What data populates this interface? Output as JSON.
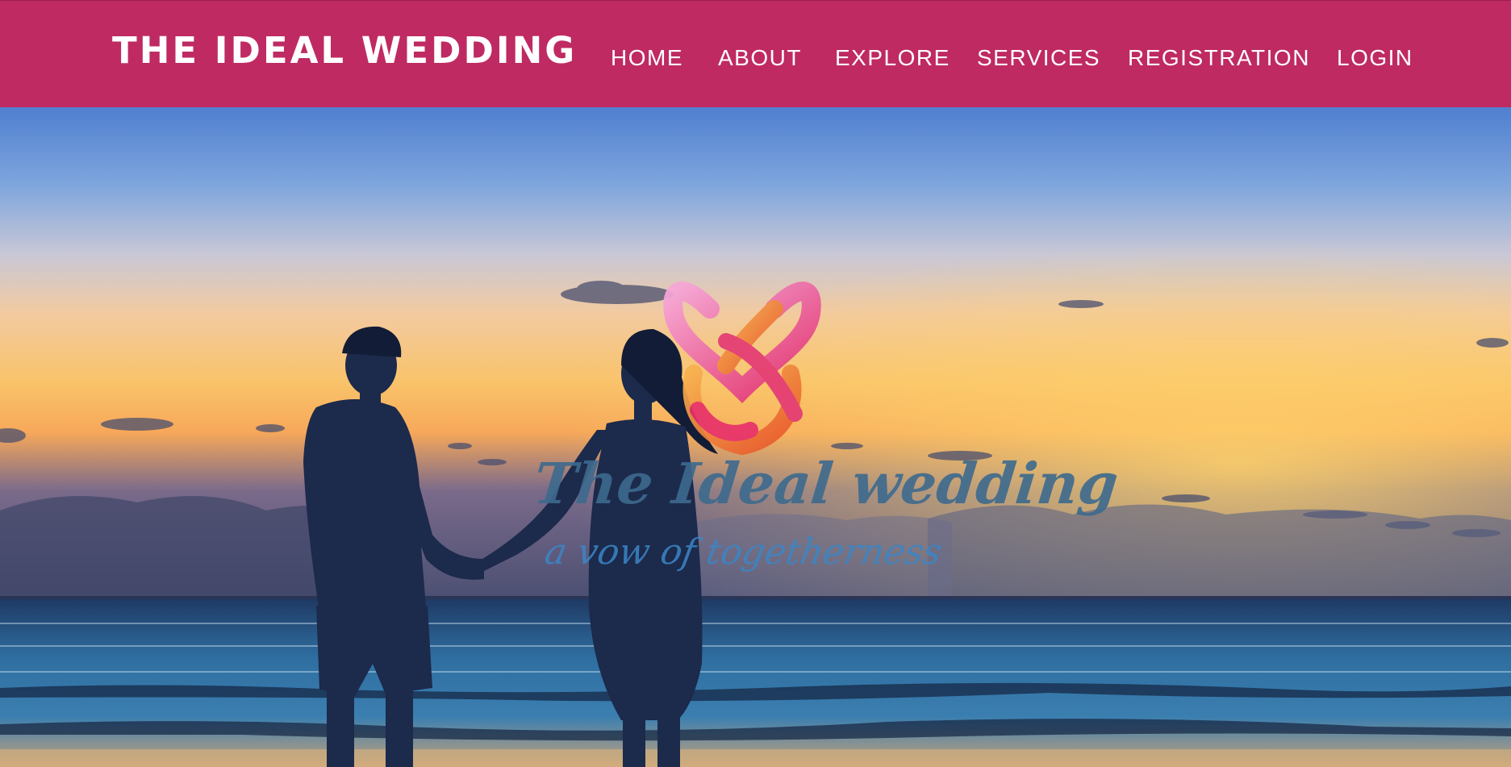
{
  "brand": {
    "name": "THE IDEAL WEDDING"
  },
  "nav": {
    "items": [
      {
        "label": "HOME"
      },
      {
        "label": "ABOUT"
      },
      {
        "label": "EXPLORE"
      },
      {
        "label": "SERVICES"
      },
      {
        "label": "REGISTRATION"
      },
      {
        "label": "LOGIN"
      }
    ]
  },
  "hero": {
    "logo_title": "The Ideal wedding",
    "logo_tagline": "a vow of togetherness",
    "logo_mark_icon": "interlocked-hearts-icon"
  },
  "colors": {
    "navbar": "#bf2a62",
    "nav_text": "#ffffff",
    "logo_title": "#3d6a8e",
    "logo_tagline": "#3b86c7"
  }
}
